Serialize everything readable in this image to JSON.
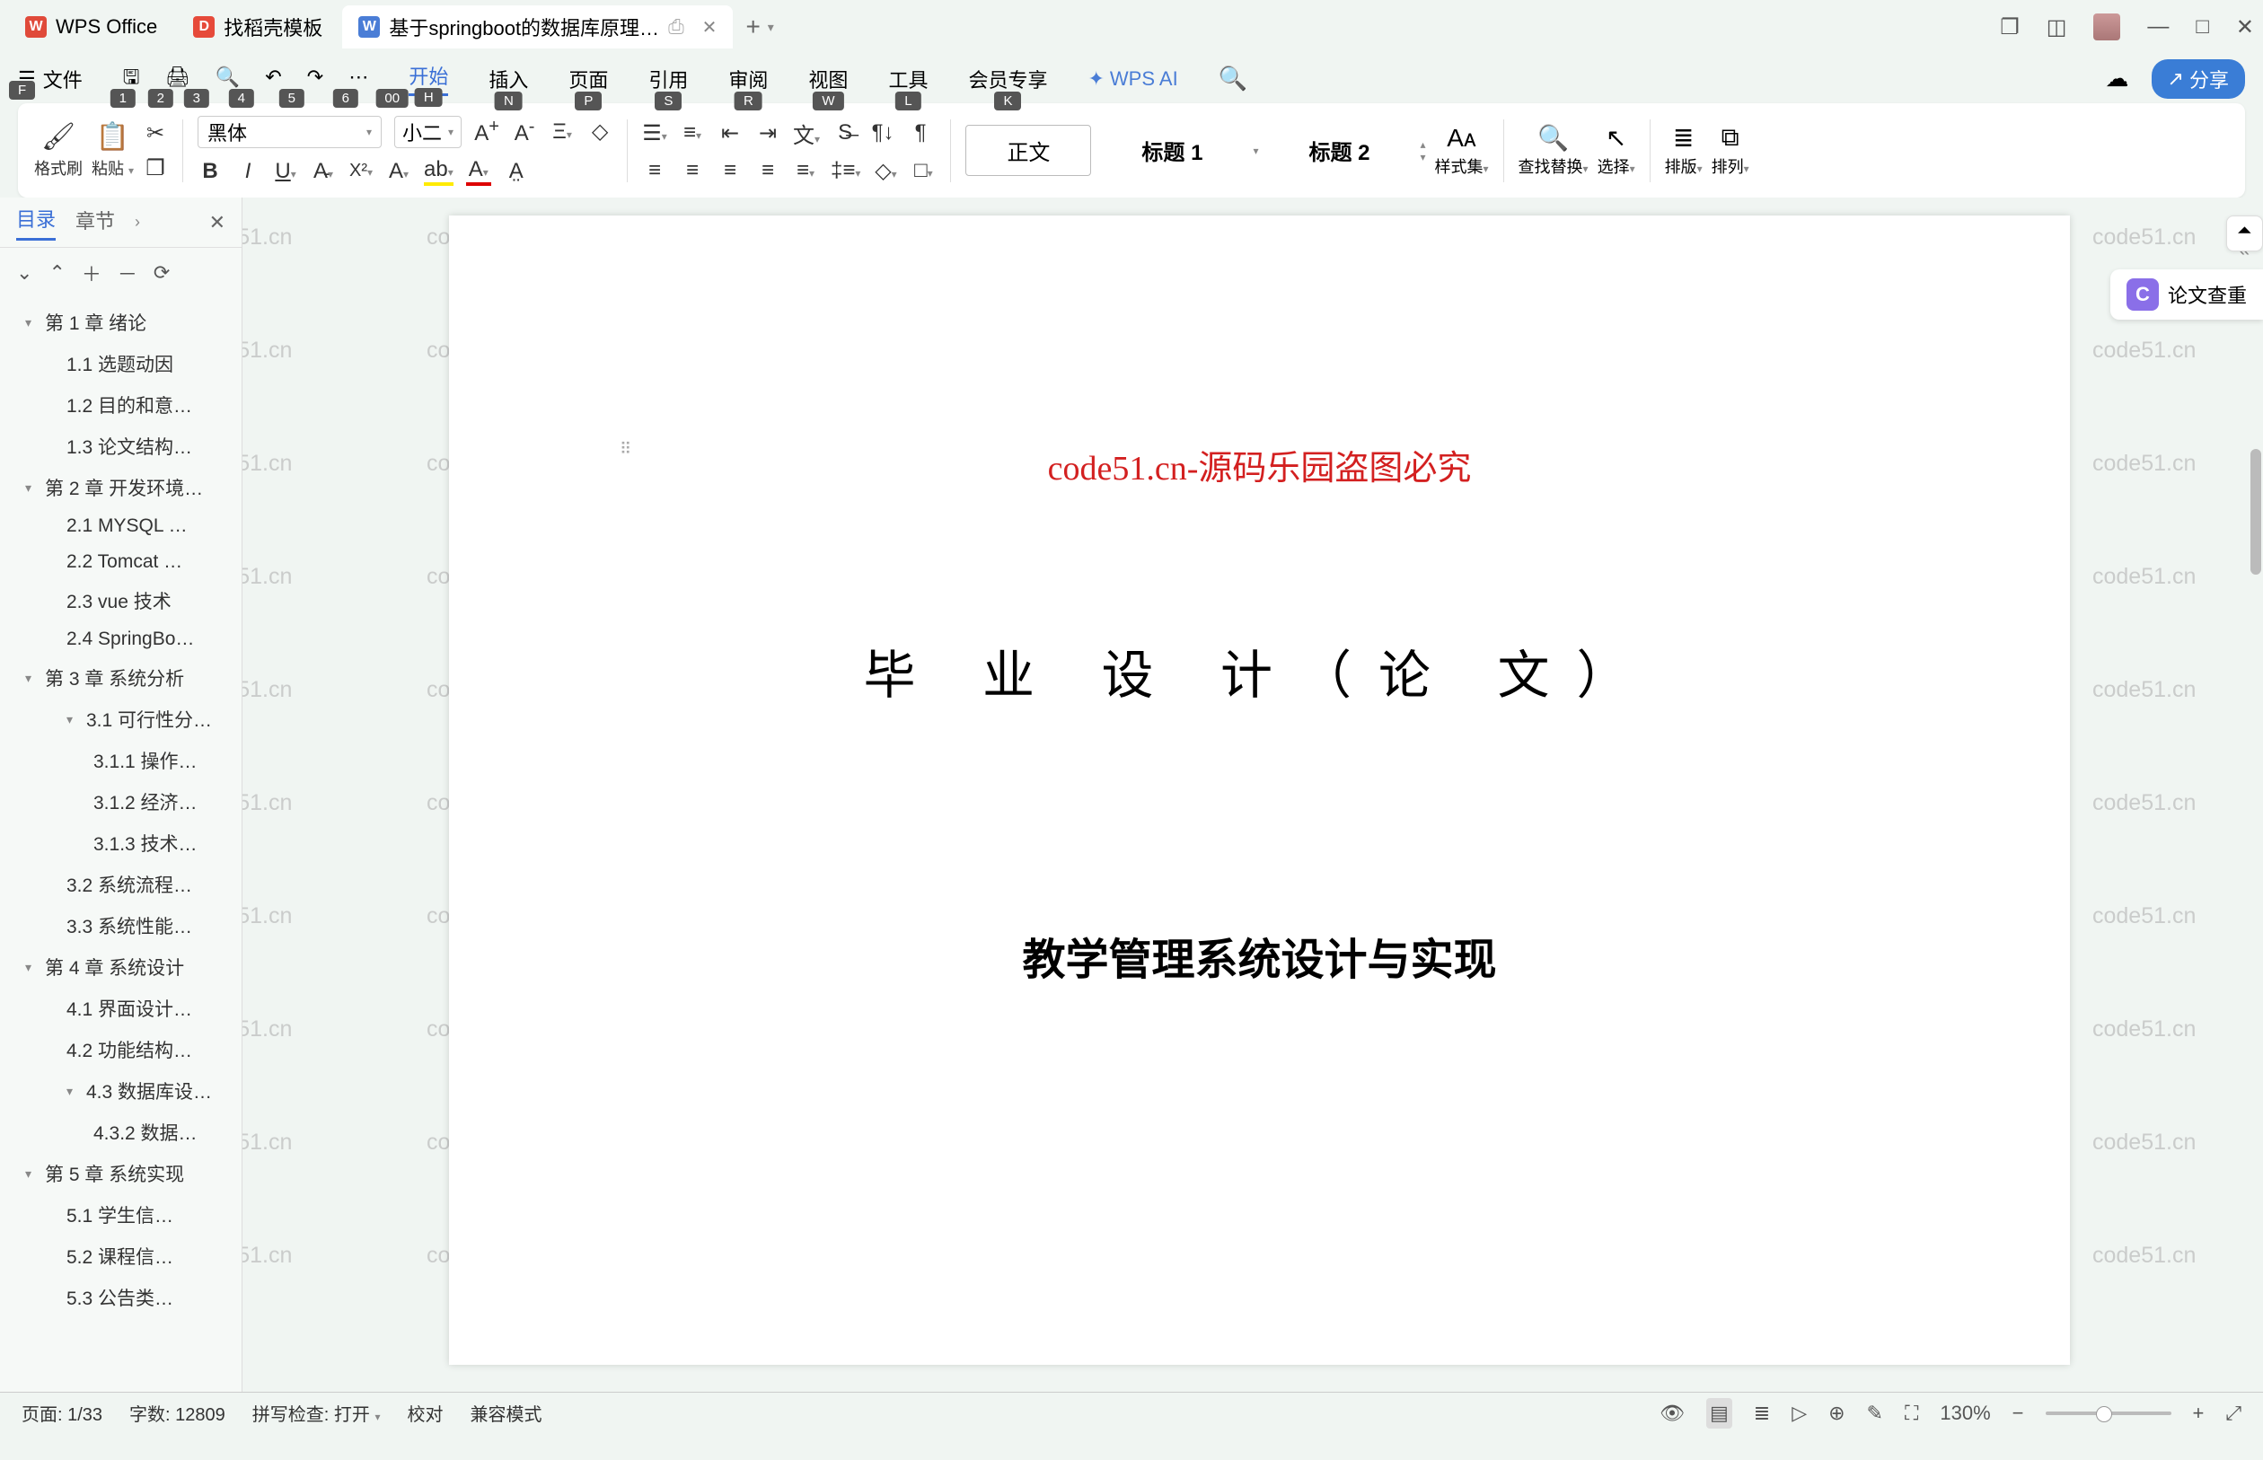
{
  "titlebar": {
    "app_name": "WPS Office",
    "tab2": "找稻壳模板",
    "tab3": "基于springboot的数据库原理…",
    "tab2_icon": "D",
    "tab3_icon": "W"
  },
  "menu": {
    "file": "文件",
    "start": "开始",
    "insert": "插入",
    "page": "页面",
    "ref": "引用",
    "review": "审阅",
    "view": "视图",
    "tools": "工具",
    "member": "会员专享",
    "ai": "WPS AI",
    "share": "分享",
    "keys": {
      "file": "F",
      "q1": "1",
      "q2": "2",
      "q3": "3",
      "q4": "4",
      "q5": "5",
      "q6": "6",
      "q00": "00",
      "start": "H",
      "insert": "N",
      "page": "P",
      "ref": "S",
      "review": "R",
      "view": "W",
      "tools": "L",
      "member": "K"
    }
  },
  "toolbar": {
    "format_painter": "格式刷",
    "paste": "粘贴",
    "font_name": "黑体",
    "font_size": "小二",
    "style_body": "正文",
    "style_h1": "标题 1",
    "style_h2": "标题 2",
    "styles": "样式集",
    "find": "查找替换",
    "select": "选择",
    "sort": "排版",
    "arrange": "排列"
  },
  "sidebar": {
    "tab_toc": "目录",
    "tab_chapter": "章节",
    "items": [
      {
        "t": "第 1 章  绪论",
        "lv": 1,
        "arr": true
      },
      {
        "t": "1.1 选题动因",
        "lv": 2
      },
      {
        "t": "1.2 目的和意…",
        "lv": 2
      },
      {
        "t": "1.3 论文结构…",
        "lv": 2
      },
      {
        "t": "第 2 章  开发环境…",
        "lv": 1,
        "arr": true
      },
      {
        "t": "2.1 MYSQL …",
        "lv": 2
      },
      {
        "t": "2.2 Tomcat …",
        "lv": 2
      },
      {
        "t": "2.3 vue 技术",
        "lv": 2
      },
      {
        "t": "2.4 SpringBo…",
        "lv": 2
      },
      {
        "t": "第 3 章  系统分析",
        "lv": 1,
        "arr": true
      },
      {
        "t": "3.1 可行性分…",
        "lv": 2,
        "arr": true
      },
      {
        "t": "3.1.1 操作…",
        "lv": 3
      },
      {
        "t": "3.1.2 经济…",
        "lv": 3
      },
      {
        "t": "3.1.3 技术…",
        "lv": 3
      },
      {
        "t": "3.2 系统流程…",
        "lv": 2
      },
      {
        "t": "3.3 系统性能…",
        "lv": 2
      },
      {
        "t": "第 4 章  系统设计",
        "lv": 1,
        "arr": true
      },
      {
        "t": "4.1 界面设计…",
        "lv": 2
      },
      {
        "t": "4.2 功能结构…",
        "lv": 2
      },
      {
        "t": "4.3 数据库设…",
        "lv": 2,
        "arr": true
      },
      {
        "t": "4.3.2  数据…",
        "lv": 3
      },
      {
        "t": "第 5 章  系统实现",
        "lv": 1,
        "arr": true
      },
      {
        "t": "5.1 学生信…",
        "lv": 2
      },
      {
        "t": "5.2 课程信…",
        "lv": 2
      },
      {
        "t": "5.3 公告类…",
        "lv": 2
      }
    ]
  },
  "doc": {
    "red_text": "code51.cn-源码乐园盗图必究",
    "title1": "毕 业 设 计（论 文）",
    "title2": "教学管理系统设计与实现"
  },
  "right": {
    "paper_check": "论文查重",
    "badge": "C"
  },
  "status": {
    "page": "页面: 1/33",
    "words": "字数: 12809",
    "spell": "拼写检查: 打开",
    "proof": "校对",
    "compat": "兼容模式",
    "zoom": "130%"
  },
  "watermark": "code51.cn"
}
